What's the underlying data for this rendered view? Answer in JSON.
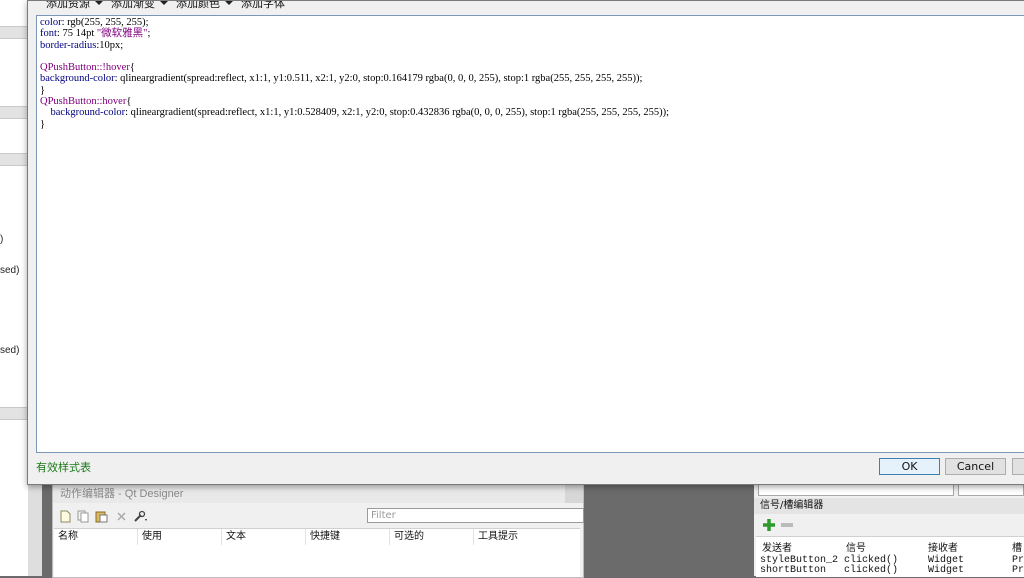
{
  "dialog": {
    "toolbar": [
      {
        "label": "添加资源"
      },
      {
        "label": "添加渐变"
      },
      {
        "label": "添加颜色"
      },
      {
        "label": "添加字体"
      }
    ],
    "code_lines": [
      {
        "parts": [
          {
            "t": "color",
            "c": "prop"
          },
          {
            "t": ": rgb(255, 255, 255);",
            "c": ""
          }
        ]
      },
      {
        "parts": [
          {
            "t": "font",
            "c": "prop"
          },
          {
            "t": ": 75 14pt ",
            "c": ""
          },
          {
            "t": "\"微软雅黑\"",
            "c": "str"
          },
          {
            "t": ";",
            "c": ""
          }
        ]
      },
      {
        "parts": [
          {
            "t": "border-radius",
            "c": "prop"
          },
          {
            "t": ":10px;",
            "c": ""
          }
        ]
      },
      {
        "parts": [
          {
            "t": "",
            "c": ""
          }
        ]
      },
      {
        "parts": [
          {
            "t": "QPushButton::!hover",
            "c": "sel"
          },
          {
            "t": "{",
            "c": ""
          }
        ]
      },
      {
        "parts": [
          {
            "t": "background-color",
            "c": "prop"
          },
          {
            "t": ": qlineargradient(spread:reflect, x1:1, y1:0.511, x2:1, y2:0, stop:0.164179 rgba(0, 0, 0, 255), stop:1 rgba(255, 255, 255, 255));",
            "c": ""
          }
        ]
      },
      {
        "parts": [
          {
            "t": "}",
            "c": ""
          }
        ]
      },
      {
        "parts": [
          {
            "t": "QPushButton::hover",
            "c": "sel"
          },
          {
            "t": "{",
            "c": ""
          }
        ]
      },
      {
        "parts": [
          {
            "t": "    ",
            "c": ""
          },
          {
            "t": "background-color",
            "c": "prop"
          },
          {
            "t": ": qlineargradient(spread:reflect, x1:1, y1:0.528409, x2:1, y2:0, stop:0.432836 rgba(0, 0, 0, 255), stop:1 rgba(255, 255, 255, 255));",
            "c": ""
          }
        ]
      },
      {
        "parts": [
          {
            "t": "}",
            "c": ""
          }
        ]
      }
    ],
    "status": "有效样式表",
    "ok_label": "OK",
    "cancel_label": "Cancel"
  },
  "background_left": {
    "fragment1": "sed)",
    "fragment2": "sed)"
  },
  "action_editor": {
    "title": "动作编辑器 - Qt Designer",
    "filter_placeholder": "Filter",
    "columns": [
      "名称",
      "使用",
      "文本",
      "快捷键",
      "可选的",
      "工具提示"
    ]
  },
  "signal_editor": {
    "title": "信号/槽编辑器",
    "columns": [
      "发送者",
      "信号",
      "接收者",
      "槽"
    ],
    "rows": [
      {
        "sender": "styleButton_2",
        "signal": "clicked()",
        "receiver": "Widget",
        "slot": "Pre"
      },
      {
        "sender": "shortButton",
        "signal": "clicked()",
        "receiver": "Widget",
        "slot": "Pre"
      }
    ]
  },
  "colors": {
    "status_green": "#1a7a1a",
    "code_property": "#000080",
    "code_selector": "#800080"
  }
}
